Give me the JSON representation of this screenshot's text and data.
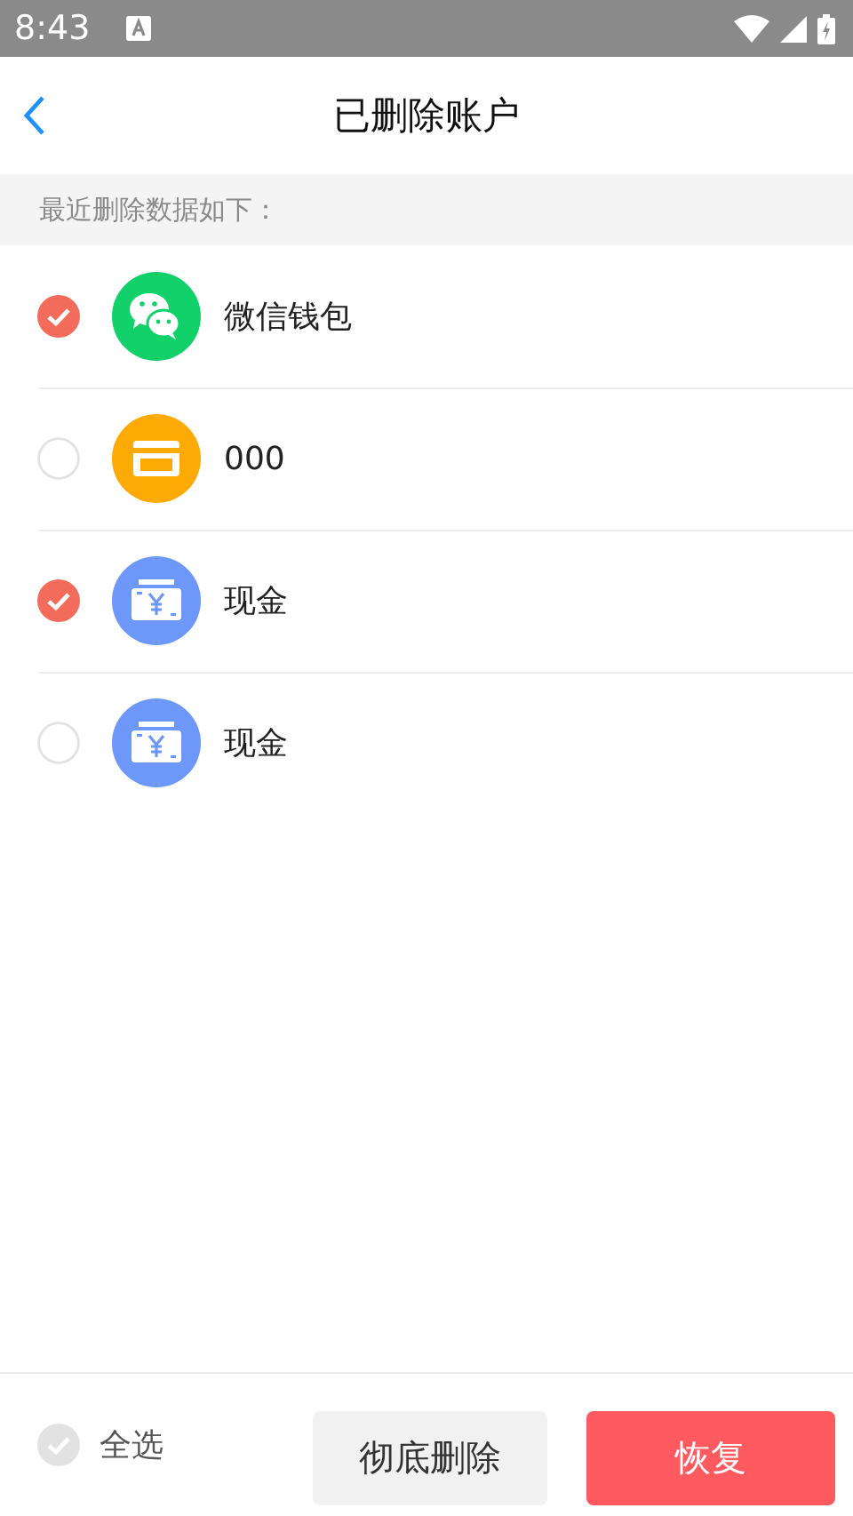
{
  "status_bar": {
    "time": "8:43"
  },
  "header": {
    "title": "已删除账户"
  },
  "section_label": "最近删除数据如下：",
  "accounts": [
    {
      "name": "微信钱包",
      "kind": "wechat",
      "checked": true
    },
    {
      "name": "000",
      "kind": "vip",
      "checked": false
    },
    {
      "name": "现金",
      "kind": "cash",
      "checked": true
    },
    {
      "name": "现金",
      "kind": "cash",
      "checked": false
    }
  ],
  "footer": {
    "select_all": {
      "label": "全选",
      "checked": false
    },
    "delete_button": "彻底删除",
    "restore_button": "恢复"
  }
}
